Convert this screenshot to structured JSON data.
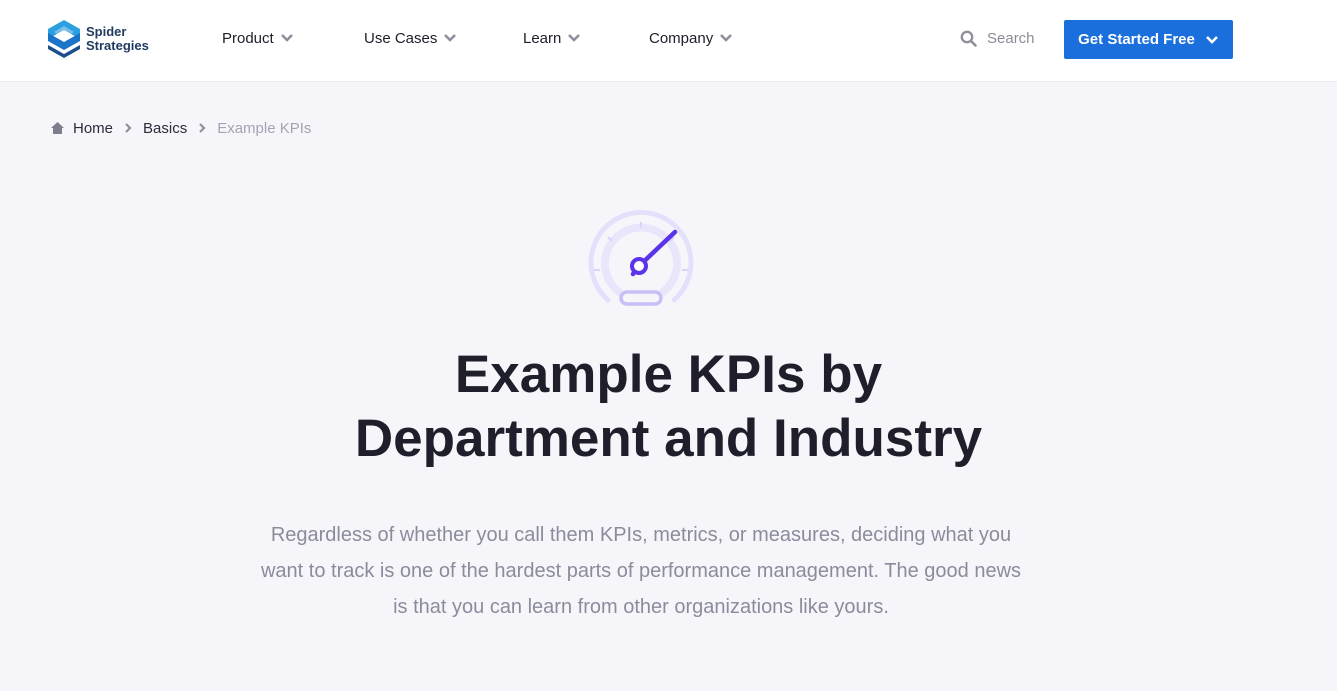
{
  "brand": {
    "name_line1": "Spider",
    "name_line2": "Strategies"
  },
  "nav": {
    "items": [
      {
        "label": "Product"
      },
      {
        "label": "Use Cases"
      },
      {
        "label": "Learn"
      },
      {
        "label": "Company"
      }
    ],
    "search_label": "Search",
    "cta_label": "Get Started Free"
  },
  "breadcrumb": {
    "home": "Home",
    "basics": "Basics",
    "current": "Example KPIs"
  },
  "hero": {
    "title_line1": "Example KPIs by",
    "title_line2": "Department and Industry",
    "lead": "Regardless of whether you call them KPIs, metrics, or measures, deciding what you want to track is one of the hardest parts of performance management. The good news is that you can learn from other organizations like yours."
  },
  "colors": {
    "accent": "#1a6fdd",
    "gauge_needle": "#5b33e8",
    "gauge_ring": "#e4e0fb",
    "gauge_pill": "#c9bff7"
  },
  "icons": {
    "logo": "spider-strategies-logo",
    "chevron": "chevron-down-icon",
    "search": "search-icon",
    "home": "home-icon",
    "separator": "chevron-right-icon",
    "gauge": "speedometer-icon"
  }
}
